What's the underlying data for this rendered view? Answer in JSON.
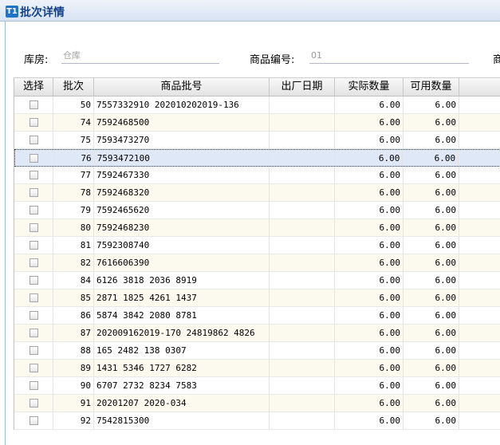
{
  "window": {
    "icon_text": "T1",
    "title": "批次详情"
  },
  "filters": {
    "warehouse_label": "库房:",
    "warehouse_placeholder": "仓库",
    "product_code_label": "商品编号:",
    "product_code_value": "01",
    "truncated_label": "商"
  },
  "grid": {
    "columns": [
      "选择",
      "批次",
      "商品批号",
      "出厂日期",
      "实际数量",
      "可用数量"
    ],
    "rows": [
      {
        "batch": "50",
        "lot": "7557332910 202010202019-136",
        "date": "",
        "actual": "6.00",
        "available": "6.00"
      },
      {
        "batch": "74",
        "lot": "7592468500",
        "date": "",
        "actual": "6.00",
        "available": "6.00"
      },
      {
        "batch": "75",
        "lot": "7593473270",
        "date": "",
        "actual": "6.00",
        "available": "6.00"
      },
      {
        "batch": "76",
        "lot": "7593472100",
        "date": "",
        "actual": "6.00",
        "available": "6.00",
        "selected": true
      },
      {
        "batch": "77",
        "lot": "7592467330",
        "date": "",
        "actual": "6.00",
        "available": "6.00"
      },
      {
        "batch": "78",
        "lot": "7592468320",
        "date": "",
        "actual": "6.00",
        "available": "6.00"
      },
      {
        "batch": "79",
        "lot": "7592465620",
        "date": "",
        "actual": "6.00",
        "available": "6.00"
      },
      {
        "batch": "80",
        "lot": "7592468230",
        "date": "",
        "actual": "6.00",
        "available": "6.00"
      },
      {
        "batch": "81",
        "lot": "7592308740",
        "date": "",
        "actual": "6.00",
        "available": "6.00"
      },
      {
        "batch": "82",
        "lot": "7616606390",
        "date": "",
        "actual": "6.00",
        "available": "6.00"
      },
      {
        "batch": "84",
        "lot": "6126 3818 2036 8919",
        "date": "",
        "actual": "6.00",
        "available": "6.00"
      },
      {
        "batch": "85",
        "lot": "2871 1825 4261 1437",
        "date": "",
        "actual": "6.00",
        "available": "6.00"
      },
      {
        "batch": "86",
        "lot": "5874 3842 2080 8781",
        "date": "",
        "actual": "6.00",
        "available": "6.00"
      },
      {
        "batch": "87",
        "lot": "202009162019-170 24819862 4826",
        "date": "",
        "actual": "6.00",
        "available": "6.00"
      },
      {
        "batch": "88",
        "lot": "165 2482 138 0307",
        "date": "",
        "actual": "6.00",
        "available": "6.00"
      },
      {
        "batch": "89",
        "lot": "1431 5346 1727 6282",
        "date": "",
        "actual": "6.00",
        "available": "6.00"
      },
      {
        "batch": "90",
        "lot": "6707 2732 8234 7583",
        "date": "",
        "actual": "6.00",
        "available": "6.00"
      },
      {
        "batch": "91",
        "lot": "20201207 2020-034",
        "date": "",
        "actual": "6.00",
        "available": "6.00"
      },
      {
        "batch": "92",
        "lot": "7542815300",
        "date": "",
        "actual": "6.00",
        "available": "6.00"
      }
    ]
  }
}
